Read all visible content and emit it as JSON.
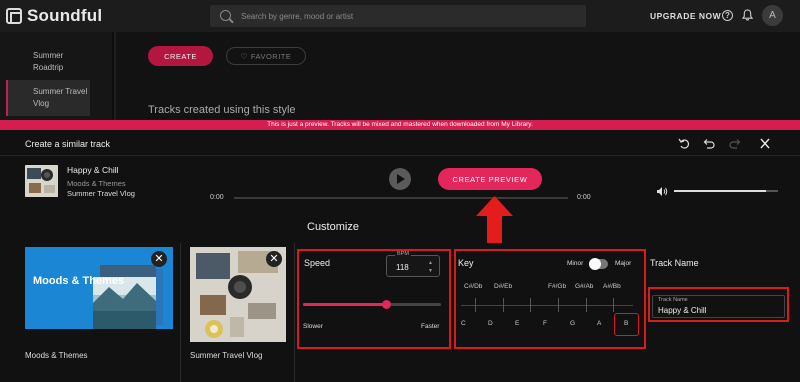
{
  "topbar": {
    "app_name": "Soundful",
    "search_placeholder": "Search by genre, mood or artist",
    "upgrade_label": "UPGRADE NOW",
    "help_glyph": "?",
    "avatar_initial": "A",
    "icons": [
      "soundful-logo-icon",
      "search-icon",
      "help-icon",
      "bell-icon"
    ]
  },
  "sidebar": {
    "items": [
      {
        "label": "Summer Roadtrip",
        "active": false
      },
      {
        "label": "Summer Travel Vlog",
        "active": true
      }
    ]
  },
  "background_page": {
    "create_label": "CREATE",
    "favorite_label": "FAVORITE",
    "tracks_heading": "Tracks created using this style"
  },
  "banner": {
    "text": "This is just a preview. Tracks will be mixed and mastered when downloaded from My Library."
  },
  "panel": {
    "title": "Create a similar track",
    "header_icons": [
      "reset-icon",
      "undo-icon",
      "redo-icon",
      "close-icon"
    ]
  },
  "player": {
    "track_name": "Happy & Chill",
    "category": "Moods & Themes",
    "style": "Summer Travel Vlog",
    "elapsed": "0:00",
    "duration": "0:00",
    "create_preview_label": "CREATE PREVIEW",
    "volume": 0.88,
    "progress": 0
  },
  "customize": {
    "heading": "Customize",
    "cards": [
      {
        "title": "Moods & Themes",
        "label": "Moods & Themes"
      },
      {
        "label": "Summer Travel Vlog"
      }
    ],
    "close_glyph": "✕",
    "speed": {
      "title": "Speed",
      "bpm_label": "BPM",
      "bpm_value": "118",
      "slower_label": "Slower",
      "faster_label": "Faster",
      "slider_value": 0.6
    },
    "key": {
      "title": "Key",
      "minor_label": "Minor",
      "major_label": "Major",
      "mode": "Minor",
      "sharps": [
        "C#/Db",
        "D#/Eb",
        "F#/Gb",
        "G#/Ab",
        "A#/Bb"
      ],
      "naturals": [
        "C",
        "D",
        "E",
        "F",
        "G",
        "A",
        "B"
      ],
      "selected": "B"
    },
    "track_name": {
      "title": "Track Name",
      "field_label": "Track Name",
      "value": "Happy & Chill"
    }
  },
  "colors": {
    "accent": "#e3275c",
    "annotation_red": "#d61c1c",
    "card_blue": "#1b86d4"
  }
}
